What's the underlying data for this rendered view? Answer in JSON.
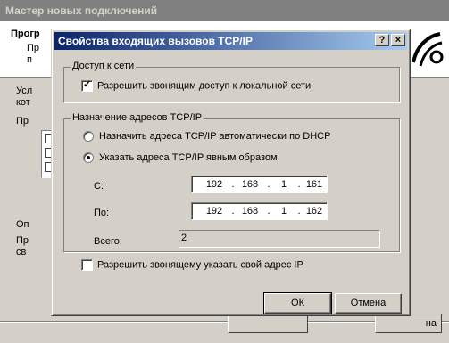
{
  "wizard": {
    "title": "Мастер новых подключений",
    "heading": "Прогр",
    "subtitle": "Пр\nп",
    "text1": "Усл\nкот",
    "list_label": "Пр",
    "text2": "Оп",
    "text3": "Пр\nсв",
    "btn_partial": "на"
  },
  "dialog": {
    "title": "Свойства входящих вызовов TCP/IP",
    "help_button": "?",
    "close_button": "×",
    "network_group": {
      "legend": "Доступ к сети",
      "allow_lan_label": "Разрешить звонящим доступ к локальной сети",
      "allow_lan_checked": true
    },
    "address_group": {
      "legend": "Назначение адресов TCP/IP",
      "dhcp_label": "Назначить адреса TCP/IP автоматически по DHCP",
      "explicit_label": "Указать адреса TCP/IP явным образом",
      "selected": "explicit",
      "from_label": "С:",
      "from_ip": [
        "192",
        "168",
        "1",
        "161"
      ],
      "to_label": "По:",
      "to_ip": [
        "192",
        "168",
        "1",
        "162"
      ],
      "total_label": "Всего:",
      "total_value": "2"
    },
    "allow_caller_ip_label": "Разрешить звонящему указать свой адрес IP",
    "allow_caller_ip_checked": false,
    "ok_label": "ОК",
    "cancel_label": "Отмена"
  }
}
